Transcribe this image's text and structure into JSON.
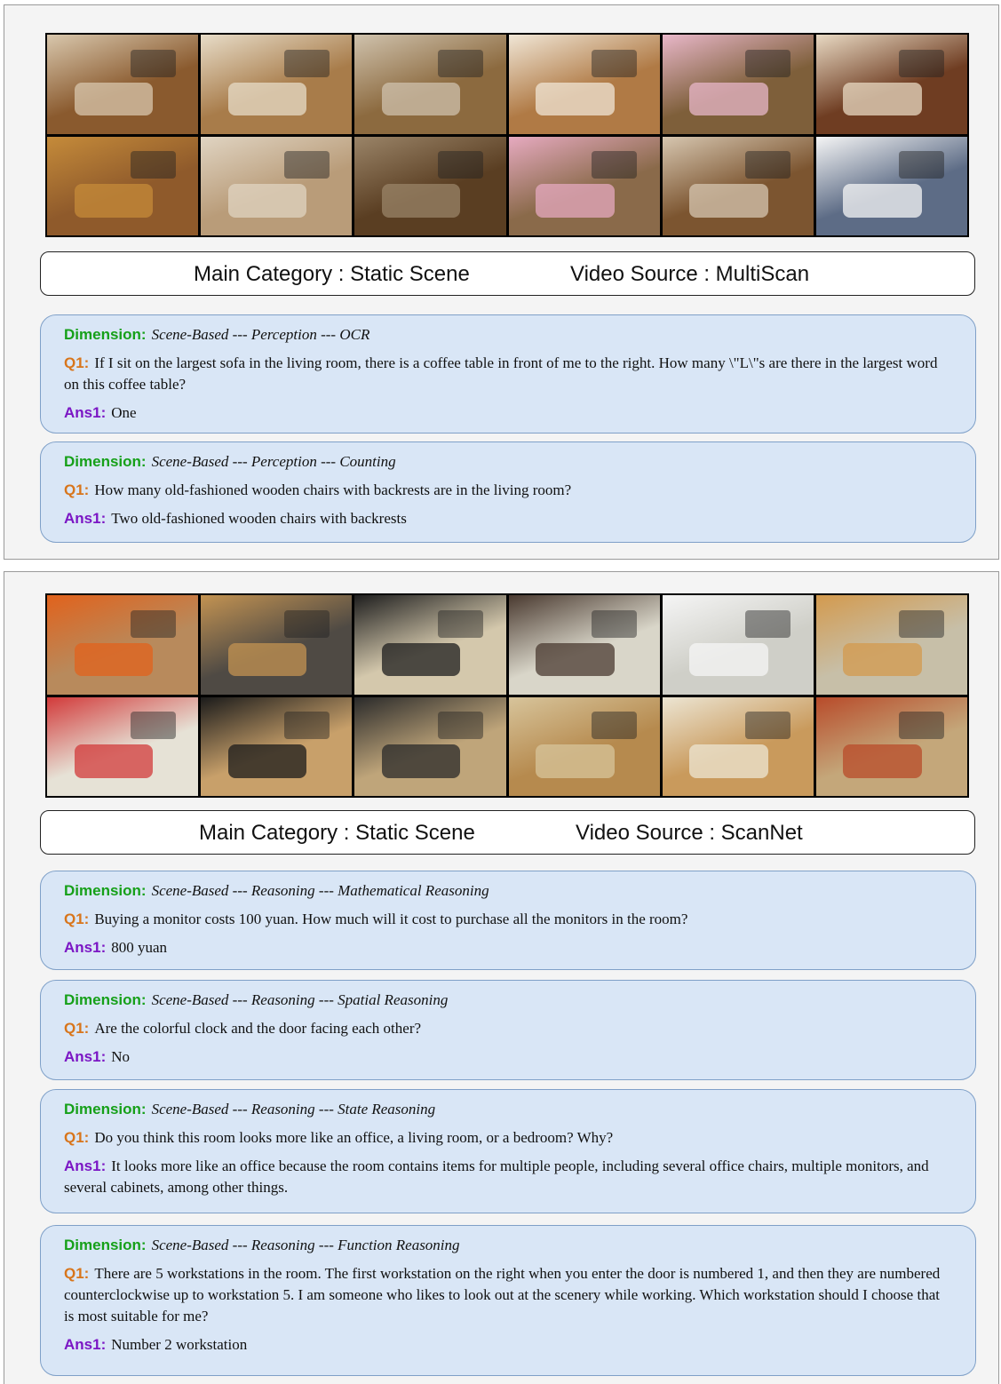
{
  "panels": [
    {
      "frames": [
        {
          "icon": "living-room-sofa-frame",
          "bg": "#8a5a2e",
          "accent": "#d8c7ad"
        },
        {
          "icon": "coffee-table-kettle-frame",
          "bg": "#a87c4a",
          "accent": "#e7dcc8"
        },
        {
          "icon": "window-shelf-frame",
          "bg": "#8c6a3f",
          "accent": "#cfc2ad"
        },
        {
          "icon": "chair-fan-frame",
          "bg": "#b07a45",
          "accent": "#f0e6d6"
        },
        {
          "icon": "table-cloth-frame",
          "bg": "#7e5f3a",
          "accent": "#e8b7c9"
        },
        {
          "icon": "sofa-cushion-frame",
          "bg": "#6f3d22",
          "accent": "#e8d9c3"
        },
        {
          "icon": "armchair-board-game-frame",
          "bg": "#8f5a2b",
          "accent": "#c58b3a"
        },
        {
          "icon": "leather-sofa-frame",
          "bg": "#b99c79",
          "accent": "#e0d4c2"
        },
        {
          "icon": "table-edge-frame",
          "bg": "#5a3e22",
          "accent": "#9a8468"
        },
        {
          "icon": "pink-cloth-stool-frame",
          "bg": "#8a6a4a",
          "accent": "#e6aac0"
        },
        {
          "icon": "room-overview-frame",
          "bg": "#7c5530",
          "accent": "#d6c6b0"
        },
        {
          "icon": "ceiling-lamp-frame",
          "bg": "#5d6c86",
          "accent": "#f5f5f5"
        }
      ],
      "info": {
        "category": "Main Category : Static Scene",
        "source": "Video Source : MultiScan"
      },
      "cards": [
        {
          "dim_label": "Dimension:",
          "dim_value": "Scene-Based --- Perception --- OCR",
          "q_label": "Q1:",
          "q_text": "If I sit on the largest sofa in the living room, there is a coffee table in front of me to the right. How many \\\"L\\\"s are there in the largest word on this coffee table?",
          "a_label": "Ans1:",
          "a_text": "One"
        },
        {
          "dim_label": "Dimension:",
          "dim_value": "Scene-Based --- Perception --- Counting",
          "q_label": "Q1:",
          "q_text": "How many old-fashioned wooden chairs with backrests are in the living room?",
          "a_label": "Ans1:",
          "a_text": "Two old-fashioned wooden chairs with backrests"
        }
      ]
    },
    {
      "frames": [
        {
          "icon": "office-orange-sofa-frame",
          "bg": "#b88a5c",
          "accent": "#e1621c"
        },
        {
          "icon": "office-window-desk-frame",
          "bg": "#4f4a44",
          "accent": "#c39352"
        },
        {
          "icon": "desk-monitor-frame",
          "bg": "#d4c8ac",
          "accent": "#1e1e1e"
        },
        {
          "icon": "whiteboard-door-frame",
          "bg": "#d9d6c9",
          "accent": "#4a3a30"
        },
        {
          "icon": "whiteboard-frame",
          "bg": "#cfcfc8",
          "accent": "#f5f5f5"
        },
        {
          "icon": "desk-toys-frame",
          "bg": "#c7bfa8",
          "accent": "#d39a4e"
        },
        {
          "icon": "posters-wall-frame",
          "bg": "#e6e2d6",
          "accent": "#d23a3a"
        },
        {
          "icon": "monitor-keyboard-frame",
          "bg": "#c8a06a",
          "accent": "#1b1b1b"
        },
        {
          "icon": "desk-chair-frame",
          "bg": "#bfa57a",
          "accent": "#2a2a2a"
        },
        {
          "icon": "bookshelf-drawer-frame",
          "bg": "#b68a4e",
          "accent": "#d7c49b"
        },
        {
          "icon": "shelf-books-frame",
          "bg": "#c99a5c",
          "accent": "#ece5d3"
        },
        {
          "icon": "posters-desk-frame",
          "bg": "#c4a77a",
          "accent": "#b84b2a"
        }
      ],
      "info": {
        "category": "Main Category : Static Scene",
        "source": "Video Source : ScanNet"
      },
      "cards": [
        {
          "dim_label": "Dimension:",
          "dim_value": "Scene-Based --- Reasoning --- Mathematical Reasoning",
          "q_label": "Q1:",
          "q_text": "Buying a monitor costs 100 yuan. How much will it cost to purchase all the monitors in the room?",
          "a_label": "Ans1:",
          "a_text": "800 yuan"
        },
        {
          "dim_label": "Dimension:",
          "dim_value": "Scene-Based --- Reasoning --- Spatial Reasoning",
          "q_label": "Q1:",
          "q_text": "Are the colorful clock and the door facing each other?",
          "a_label": "Ans1:",
          "a_text": "No"
        },
        {
          "dim_label": "Dimension:",
          "dim_value": "Scene-Based --- Reasoning --- State Reasoning",
          "q_label": "Q1:",
          "q_text": "Do you think this room looks more like an office, a living room, or a bedroom? Why?",
          "a_label": "Ans1:",
          "a_text": "It looks more like an office because the room contains items for multiple people, including several office chairs, multiple monitors, and several cabinets, among other things."
        },
        {
          "dim_label": "Dimension:",
          "dim_value": "Scene-Based --- Reasoning --- Function Reasoning",
          "q_label": "Q1:",
          "q_text": "There are 5 workstations in the room. The first workstation on the right when you enter the door is numbered 1, and then they are numbered counterclockwise up to workstation 5. I am someone who likes to look out at the scenery while working. Which workstation should I choose that is most suitable for me?",
          "a_label": "Ans1:",
          "a_text": "Number 2 workstation"
        }
      ]
    }
  ]
}
